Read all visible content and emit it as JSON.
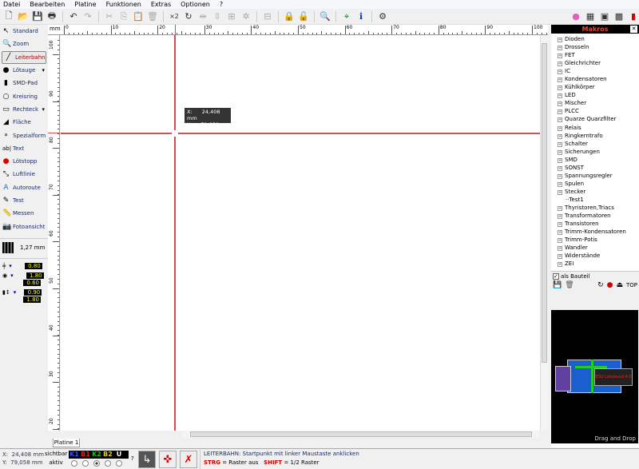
{
  "menu": [
    "Datei",
    "Bearbeiten",
    "Platine",
    "Funktionen",
    "Extras",
    "Optionen",
    "?"
  ],
  "toolbar": {
    "icons": [
      "new-icon",
      "open-icon",
      "save-icon",
      "print-icon",
      "undo-icon",
      "redo-icon",
      "cut-icon",
      "copy-icon",
      "paste-icon",
      "delete-icon",
      "duplicate-x2-icon",
      "rotate-icon",
      "mirror-h-icon",
      "mirror-v-icon",
      "align-icon",
      "grid-icon",
      "group-icon",
      "lock-icon",
      "unlock-icon",
      "zoom-icon",
      "crosshair-icon",
      "info-icon",
      "chip-icon"
    ],
    "x2_label": "×2",
    "right_icons": [
      "pink-circle-icon",
      "drc-1-icon",
      "drc-2-icon",
      "drc-icon",
      "m-icon"
    ]
  },
  "tools": [
    {
      "label": "Standard",
      "icon": "cursor-icon"
    },
    {
      "label": "Zoom",
      "icon": "zoom-icon"
    },
    {
      "label": "Leiterbahn",
      "icon": "track-icon",
      "active": true
    },
    {
      "label": "Lötauge",
      "icon": "pad-icon",
      "dropdown": true
    },
    {
      "label": "SMD-Pad",
      "icon": "smd-pad-icon"
    },
    {
      "label": "Kreisring",
      "icon": "circle-icon"
    },
    {
      "label": "Rechteck",
      "icon": "rectangle-icon",
      "dropdown": true
    },
    {
      "label": "Fläche",
      "icon": "area-icon"
    },
    {
      "label": "Spezialform",
      "icon": "special-shape-icon"
    },
    {
      "label": "Text",
      "icon": "text-icon"
    },
    {
      "label": "Lötstopp",
      "icon": "solder-stop-icon"
    },
    {
      "label": "Luftlinie",
      "icon": "airwire-icon"
    },
    {
      "label": "Autoroute",
      "icon": "autoroute-icon"
    },
    {
      "label": "Test",
      "icon": "test-icon"
    },
    {
      "label": "Messen",
      "icon": "measure-icon"
    },
    {
      "label": "Fotoansicht",
      "icon": "photo-view-icon"
    }
  ],
  "grid": {
    "value": "1,27 mm"
  },
  "params": {
    "track_width": "0.80",
    "pad_outer": "1.80",
    "pad_inner": "0.60",
    "smd_w": "0.90",
    "smd_h": "1.80"
  },
  "ruler": {
    "unit": "mm",
    "x_labels": [
      "0",
      "10",
      "20",
      "30",
      "40",
      "50",
      "60",
      "70",
      "80",
      "90",
      "100"
    ],
    "y_labels": [
      "100",
      "90",
      "80",
      "70",
      "60",
      "50",
      "40",
      "30",
      "20"
    ]
  },
  "cursor_tooltip": {
    "x_label": "X:",
    "x": "24,408 mm",
    "y_label": "Y:",
    "y": "79,058 mm"
  },
  "crosshair_color": "#d05050",
  "tabs": [
    "Platine 1"
  ],
  "makros": {
    "title": "Makros",
    "items": [
      "Dioden",
      "Drosseln",
      "FET",
      "Gleichrichter",
      "IC",
      "Kondensatoren",
      "Kühlkörper",
      "LED",
      "Mischer",
      "PLCC",
      "Quarze Quarzfilter",
      "Relais",
      "Ringkerntrafo",
      "Schalter",
      "Sicherungen",
      "SMD",
      "SONST",
      "Spannungsregler",
      "Spulen",
      "Stecker",
      "Test1",
      "Thyristoren,Triacs",
      "Transformatoren",
      "Transistoren",
      "Trimm-Kondensatoren",
      "Trimm-Potis",
      "Wandler",
      "Widerstände",
      "ZEI"
    ],
    "leaf": "Test1",
    "checkbox_label": "als Bauteil",
    "checkbox_checked": true,
    "top_label": "TOP",
    "preview_label": "ESU Loksound 4.0",
    "drag_label": "Drag and Drop"
  },
  "status": {
    "x_label": "X:",
    "x": "24,408 mm",
    "y_label": "Y:",
    "y": "79,058 mm",
    "sichtbar": "sichtbar",
    "aktiv": "aktiv",
    "layers": [
      {
        "name": "K1",
        "color": "#3050ff"
      },
      {
        "name": "B1",
        "color": "#e02020"
      },
      {
        "name": "K2",
        "color": "#20c020"
      },
      {
        "name": "B2",
        "color": "#e0d020"
      },
      {
        "name": "U",
        "color": "#ffffff"
      }
    ],
    "active_layer": "K2",
    "question": "?",
    "hint": "LEITERBAHN:  Startpunkt mit linker Maustaste anklicken",
    "strg": "STRG",
    "strg_text": "= Raster aus",
    "shift": "SHIFT",
    "shift_text": "= 1/2 Raster"
  }
}
